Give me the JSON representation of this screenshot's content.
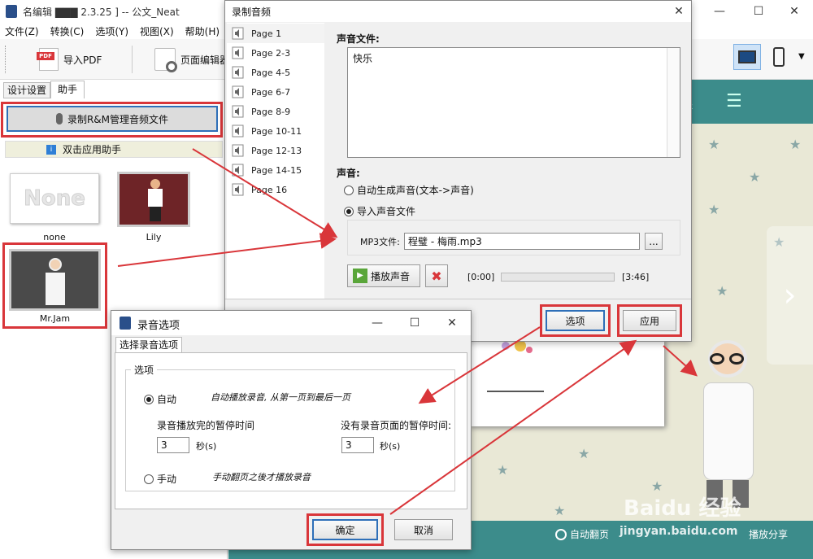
{
  "app": {
    "title": "名编辑 ▇▇▇ 2.3.25 ] -- 公文_Neat",
    "menu": [
      "文件(Z)",
      "转换(C)",
      "选项(Y)",
      "视图(X)",
      "帮助(H)"
    ],
    "toolbar": {
      "import_pdf": "导入PDF",
      "page_edit": "页面编辑器"
    },
    "tabs": [
      "设计设置",
      "助手"
    ],
    "record_btn": "录制R&M管理音频文件",
    "helper_btn": "双击应用助手",
    "assistants": [
      {
        "name": "none",
        "thumb_text": "None"
      },
      {
        "name": "Lily"
      },
      {
        "name": "Mr.Jam"
      }
    ],
    "bottom_bar": {
      "autoflip": "自动翻页",
      "share": "播放分享"
    },
    "watermark": {
      "brand": "Baidu 经验",
      "url": "jingyan.baidu.com"
    }
  },
  "dlg_audio": {
    "title": "录制音频",
    "pages": [
      "Page 1",
      "Page 2-3",
      "Page 4-5",
      "Page 6-7",
      "Page 8-9",
      "Page 10-11",
      "Page 12-13",
      "Page 14-15",
      "Page 16"
    ],
    "sound_file_label": "声音文件:",
    "sound_text": "快乐",
    "sound_label": "声音:",
    "opt_auto": "自动生成声音(文本->声音)",
    "opt_import": "导入声音文件",
    "mp3_label": "MP3文件:",
    "mp3_value": "程璧 - 梅雨.mp3",
    "browse": "...",
    "play": "播放声音",
    "time_start": "[0:00]",
    "time_end": "[3:46]",
    "options_btn": "选项",
    "apply_btn": "应用"
  },
  "dlg_rec": {
    "title": "录音选项",
    "tab": "选择录音选项",
    "group": "选项",
    "auto_label": "自动",
    "auto_desc": "自动播放录音, 从第一页到最后一页",
    "pause_after_label": "录音播放完的暂停时间",
    "pause_after_value": "3",
    "no_audio_label": "没有录音页面的暂停时间:",
    "no_audio_value": "3",
    "sec": "秒(s)",
    "manual_label": "手动",
    "manual_desc": "手动翻页之後才播放录音",
    "ok": "确定",
    "cancel": "取消"
  },
  "colors": {
    "accent": "#d9363a",
    "teal": "#3c8c8b",
    "panel": "#efefdc"
  }
}
